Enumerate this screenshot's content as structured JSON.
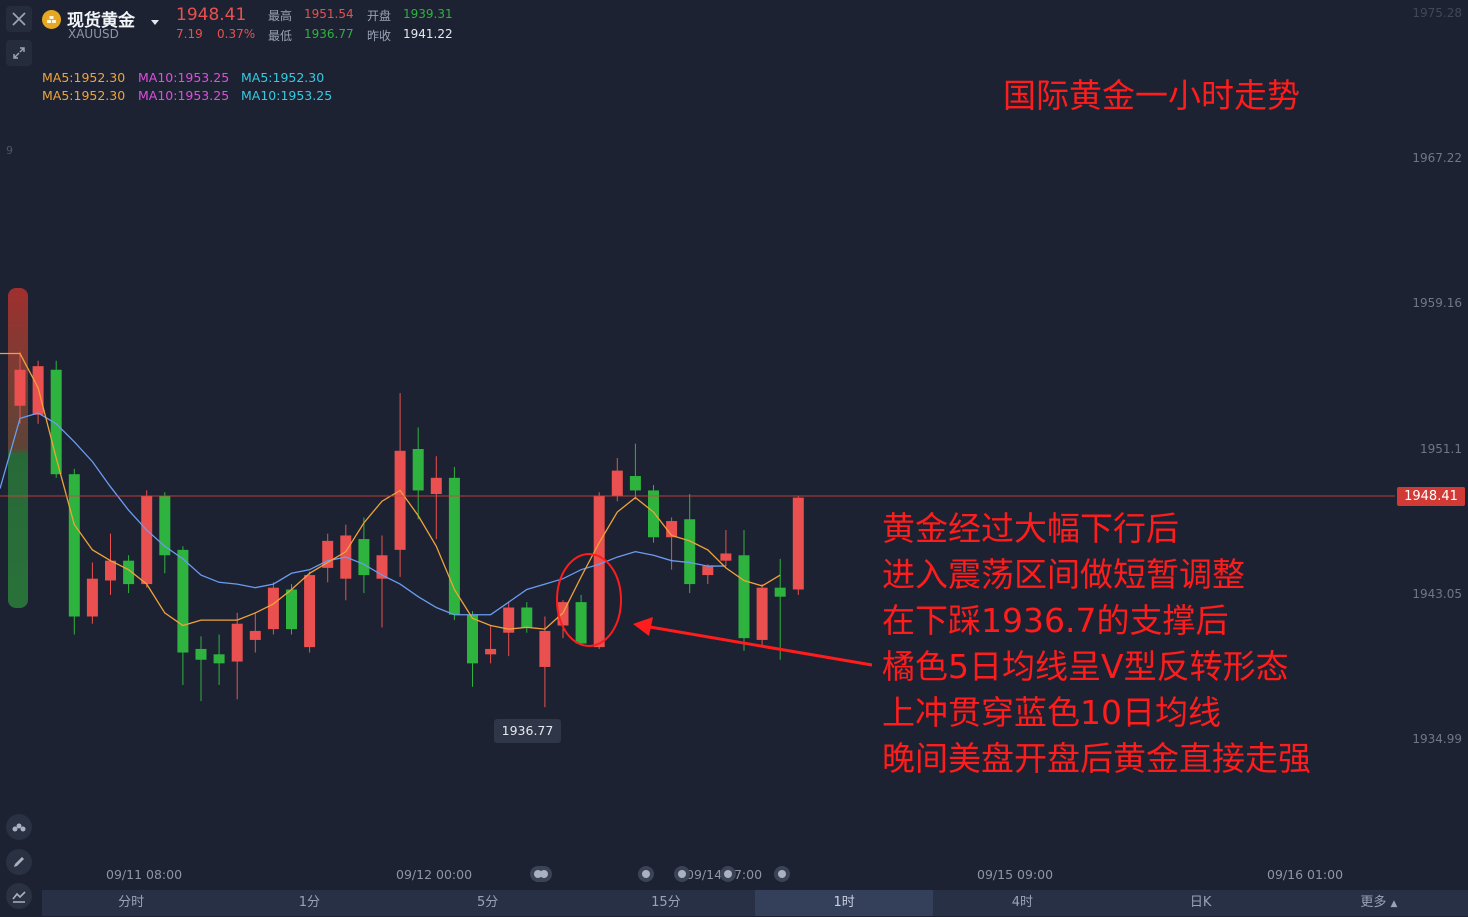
{
  "header": {
    "name": "现货黄金",
    "symbol": "XAUUSD",
    "price": "1948.41",
    "change": "7.19",
    "change_pct": "0.37%",
    "high_label": "最高",
    "high": "1951.54",
    "low_label": "最低",
    "low": "1936.77",
    "open_label": "开盘",
    "open": "1939.31",
    "prev_close_label": "昨收",
    "prev_close": "1941.22"
  },
  "ma_legend": {
    "row1": [
      "MA5:1952.30",
      "MA10:1953.25",
      "MA5:1952.30"
    ],
    "row2": [
      "MA5:1952.30",
      "MA10:1953.25",
      "MA10:1953.25"
    ]
  },
  "chart_title": "国际黄金一小时走势",
  "annotation_lines": [
    "黄金经过大幅下行后",
    "进入震荡区间做短暂调整",
    "在下踩1936.7的支撑后",
    "橘色5日均线呈V型反转形态",
    "上冲贯穿蓝色10日均线",
    "晚间美盘开盘后黄金直接走强"
  ],
  "current_price_tag": "1948.41",
  "low_marker": "1936.77",
  "tabs": [
    "分时",
    "1分",
    "5分",
    "15分",
    "1时",
    "4时",
    "日K",
    "更多"
  ],
  "active_tab": "1时",
  "partial_labels": {
    "top_axis": "1975.28",
    "left_edge": "9"
  },
  "colors": {
    "up": "#e9504f",
    "down": "#2eb33e",
    "ma5": "#f0a33a",
    "ma10": "#6b9cf2",
    "annotation": "#ff1c1c",
    "price_line": "#d4453f"
  },
  "chart_data": {
    "type": "candlestick",
    "title": "国际黄金一小时走势",
    "ylim": [
      1931.5,
      1976
    ],
    "y_ticks": [
      1967.22,
      1959.16,
      1951.1,
      1943.05,
      1934.99
    ],
    "x_ticks": [
      "09/11 08:00",
      "09/12 00:00",
      "09/14 17:00",
      "09/15 09:00",
      "09/16 01:00"
    ],
    "current_price": 1948.41,
    "low_point": 1936.77,
    "candles": [
      {
        "o": 1953.5,
        "c": 1955.5,
        "h": 1956.5,
        "l": 1952.5
      },
      {
        "o": 1953.0,
        "c": 1955.7,
        "h": 1956.0,
        "l": 1952.5
      },
      {
        "o": 1955.5,
        "c": 1949.7,
        "h": 1956.0,
        "l": 1949.5
      },
      {
        "o": 1949.7,
        "c": 1941.8,
        "h": 1950.0,
        "l": 1940.8
      },
      {
        "o": 1941.8,
        "c": 1943.9,
        "h": 1944.8,
        "l": 1941.4
      },
      {
        "o": 1943.8,
        "c": 1944.9,
        "h": 1946.4,
        "l": 1943.0
      },
      {
        "o": 1944.9,
        "c": 1943.6,
        "h": 1945.2,
        "l": 1943.1
      },
      {
        "o": 1943.6,
        "c": 1948.5,
        "h": 1948.8,
        "l": 1943.4
      },
      {
        "o": 1948.5,
        "c": 1945.2,
        "h": 1948.7,
        "l": 1944.2
      },
      {
        "o": 1945.5,
        "c": 1939.8,
        "h": 1945.7,
        "l": 1938.0
      },
      {
        "o": 1940.0,
        "c": 1939.4,
        "h": 1940.7,
        "l": 1937.1
      },
      {
        "o": 1939.7,
        "c": 1939.2,
        "h": 1940.8,
        "l": 1938.0
      },
      {
        "o": 1939.3,
        "c": 1941.4,
        "h": 1942.0,
        "l": 1937.2
      },
      {
        "o": 1940.5,
        "c": 1941.0,
        "h": 1942.0,
        "l": 1939.8
      },
      {
        "o": 1941.1,
        "c": 1943.4,
        "h": 1943.7,
        "l": 1940.8
      },
      {
        "o": 1943.3,
        "c": 1941.1,
        "h": 1943.6,
        "l": 1940.8
      },
      {
        "o": 1940.1,
        "c": 1944.1,
        "h": 1944.3,
        "l": 1939.8
      },
      {
        "o": 1944.5,
        "c": 1946.0,
        "h": 1946.4,
        "l": 1943.7
      },
      {
        "o": 1943.9,
        "c": 1946.3,
        "h": 1946.9,
        "l": 1942.7
      },
      {
        "o": 1946.1,
        "c": 1944.1,
        "h": 1947.3,
        "l": 1943.1
      },
      {
        "o": 1943.9,
        "c": 1945.2,
        "h": 1946.3,
        "l": 1941.2
      },
      {
        "o": 1945.5,
        "c": 1951.0,
        "h": 1954.2,
        "l": 1944.0
      },
      {
        "o": 1951.1,
        "c": 1948.8,
        "h": 1952.3,
        "l": 1947.2
      },
      {
        "o": 1948.6,
        "c": 1949.5,
        "h": 1950.7,
        "l": 1946.1
      },
      {
        "o": 1949.5,
        "c": 1941.9,
        "h": 1950.1,
        "l": 1941.6
      },
      {
        "o": 1941.9,
        "c": 1939.2,
        "h": 1942.1,
        "l": 1937.9
      },
      {
        "o": 1939.7,
        "c": 1940.0,
        "h": 1941.3,
        "l": 1939.2
      },
      {
        "o": 1940.9,
        "c": 1942.3,
        "h": 1942.6,
        "l": 1939.6
      },
      {
        "o": 1942.3,
        "c": 1941.2,
        "h": 1942.6,
        "l": 1940.9
      },
      {
        "o": 1939.0,
        "c": 1941.0,
        "h": 1941.8,
        "l": 1936.77
      },
      {
        "o": 1941.3,
        "c": 1942.6,
        "h": 1942.7,
        "l": 1940.6
      },
      {
        "o": 1942.6,
        "c": 1940.3,
        "h": 1943.0,
        "l": 1940.2
      },
      {
        "o": 1940.1,
        "c": 1948.5,
        "h": 1948.7,
        "l": 1940.0
      },
      {
        "o": 1948.5,
        "c": 1949.9,
        "h": 1950.6,
        "l": 1948.2
      },
      {
        "o": 1949.6,
        "c": 1948.8,
        "h": 1951.4,
        "l": 1948.3
      },
      {
        "o": 1948.8,
        "c": 1946.2,
        "h": 1949.1,
        "l": 1945.9
      },
      {
        "o": 1946.2,
        "c": 1947.1,
        "h": 1947.3,
        "l": 1944.4
      },
      {
        "o": 1947.2,
        "c": 1943.6,
        "h": 1948.6,
        "l": 1943.1
      },
      {
        "o": 1944.1,
        "c": 1944.6,
        "h": 1944.7,
        "l": 1943.6
      },
      {
        "o": 1944.9,
        "c": 1945.3,
        "h": 1946.6,
        "l": 1944.6
      },
      {
        "o": 1945.2,
        "c": 1940.6,
        "h": 1946.6,
        "l": 1939.9
      },
      {
        "o": 1940.5,
        "c": 1943.4,
        "h": 1943.6,
        "l": 1940.2
      },
      {
        "o": 1943.4,
        "c": 1942.9,
        "h": 1945.0,
        "l": 1939.4
      },
      {
        "o": 1943.3,
        "c": 1948.4,
        "h": 1948.5,
        "l": 1943.0
      }
    ],
    "ma5": [
      1956.4,
      1956.4,
      1954.5,
      1950.6,
      1946.9,
      1945.5,
      1944.9,
      1944.4,
      1943.6,
      1942.0,
      1941.3,
      1941.6,
      1941.6,
      1941.6,
      1942.0,
      1942.5,
      1943.3,
      1944.2,
      1944.8,
      1945.4,
      1947.0,
      1948.2,
      1948.8,
      1947.4,
      1945.7,
      1943.3,
      1941.7,
      1941.3,
      1941.1,
      1941.2,
      1941.1,
      1942.0,
      1944.0,
      1945.9,
      1947.6,
      1948.4,
      1947.6,
      1946.3,
      1946.0,
      1945.5,
      1944.5,
      1943.8,
      1943.5,
      1944.1
    ],
    "ma10": [
      1948.9,
      1952.8,
      1953.1,
      1952.5,
      1951.5,
      1950.4,
      1949.0,
      1947.7,
      1946.6,
      1945.7,
      1945.0,
      1944.1,
      1943.7,
      1943.6,
      1943.4,
      1943.6,
      1944.2,
      1944.4,
      1944.9,
      1945.1,
      1944.7,
      1944.1,
      1943.6,
      1942.9,
      1942.3,
      1941.9,
      1941.9,
      1941.9,
      1942.6,
      1943.3,
      1943.6,
      1943.9,
      1944.4,
      1944.7,
      1945.1,
      1945.4,
      1945.2,
      1944.9,
      1944.8,
      1944.6,
      1944.6
    ],
    "ma10_start_index": -1
  }
}
